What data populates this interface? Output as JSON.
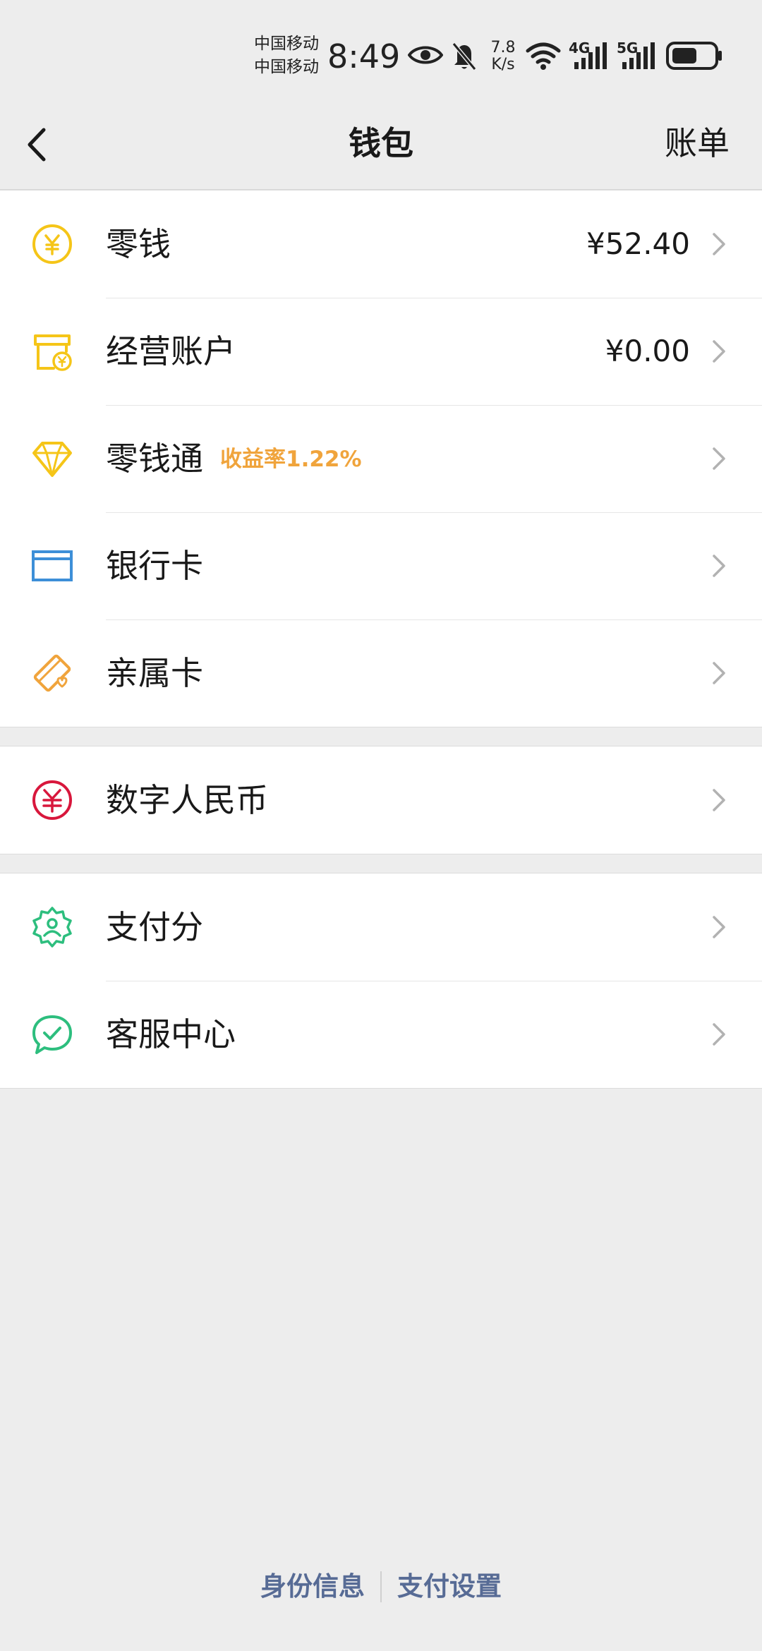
{
  "status_bar": {
    "carrier_1": "中国移动",
    "carrier_2": "中国移动",
    "time": "8:49",
    "net_speed_value": "7.8",
    "net_speed_unit": "K/s",
    "signal_1_label": "4G",
    "signal_2_label": "5G",
    "icons": [
      "eye-icon",
      "bell-off-icon",
      "wifi-icon",
      "signal-icon",
      "battery-icon"
    ]
  },
  "nav": {
    "title": "钱包",
    "action": "账单",
    "back_icon": "chevron-left-icon"
  },
  "groups": [
    {
      "items": [
        {
          "label": "零钱",
          "value": "¥52.40",
          "icon": "coin-icon",
          "icon_color": "#f5c518"
        },
        {
          "label": "经营账户",
          "value": "¥0.00",
          "icon": "store-icon",
          "icon_color": "#f5c518"
        },
        {
          "label": "零钱通",
          "badge": "收益率1.22%",
          "icon": "diamond-icon",
          "icon_color": "#f5c518"
        },
        {
          "label": "银行卡",
          "icon": "bank-card-icon",
          "icon_color": "#3d8fd8"
        },
        {
          "label": "亲属卡",
          "icon": "family-card-icon",
          "icon_color": "#f0a43c"
        }
      ]
    },
    {
      "items": [
        {
          "label": "数字人民币",
          "icon": "digital-rmb-icon",
          "icon_color": "#d8173c"
        }
      ]
    },
    {
      "items": [
        {
          "label": "支付分",
          "icon": "badge-person-icon",
          "icon_color": "#2dbe7e"
        },
        {
          "label": "客服中心",
          "icon": "chat-check-icon",
          "icon_color": "#2dbe7e"
        }
      ]
    }
  ],
  "footer": {
    "identity": "身份信息",
    "pay_settings": "支付设置"
  },
  "colors": {
    "background": "#ededed",
    "link": "#576b95",
    "badge": "#f0a43c"
  }
}
